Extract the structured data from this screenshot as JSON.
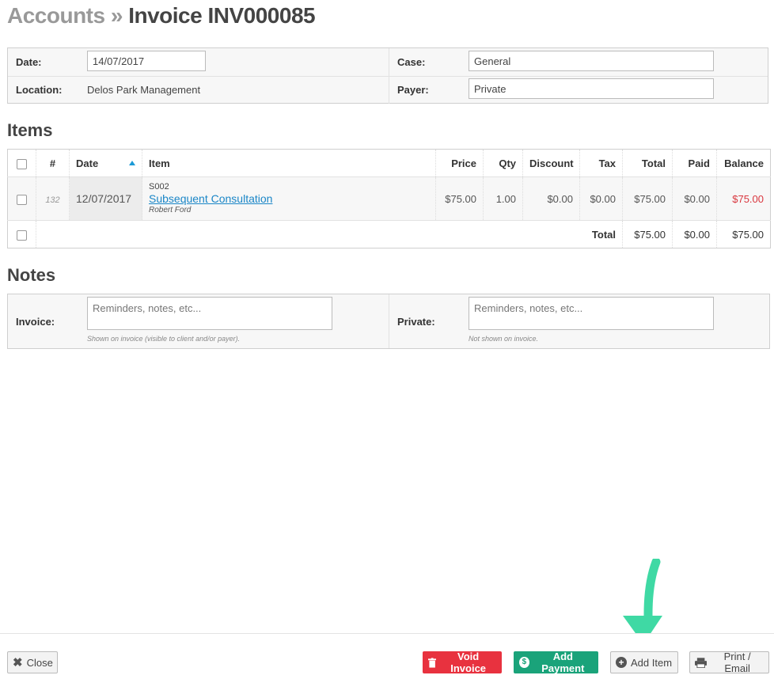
{
  "header": {
    "breadcrumb": "Accounts",
    "separator": "»",
    "title": "Invoice INV000085"
  },
  "details": {
    "date_label": "Date:",
    "date_value": "14/07/2017",
    "case_label": "Case:",
    "case_value": "General",
    "location_label": "Location:",
    "location_value": "Delos Park Management",
    "payer_label": "Payer:",
    "payer_value": "Private"
  },
  "items": {
    "heading": "Items",
    "columns": {
      "number": "#",
      "date": "Date",
      "item": "Item",
      "price": "Price",
      "qty": "Qty",
      "discount": "Discount",
      "tax": "Tax",
      "total": "Total",
      "paid": "Paid",
      "balance": "Balance"
    },
    "rows": [
      {
        "number": "132",
        "date": "12/07/2017",
        "code": "S002",
        "name": "Subsequent Consultation",
        "practitioner": "Robert Ford",
        "price": "$75.00",
        "qty": "1.00",
        "discount": "$0.00",
        "tax": "$0.00",
        "total": "$75.00",
        "paid": "$0.00",
        "balance": "$75.00"
      }
    ],
    "totals": {
      "label": "Total",
      "total": "$75.00",
      "paid": "$0.00",
      "balance": "$75.00"
    }
  },
  "notes": {
    "heading": "Notes",
    "invoice_label": "Invoice:",
    "invoice_placeholder": "Reminders, notes, etc...",
    "invoice_hint": "Shown on invoice (visible to client and/or payer).",
    "private_label": "Private:",
    "private_placeholder": "Reminders, notes, etc...",
    "private_hint": "Not shown on invoice."
  },
  "footer": {
    "close": "Close",
    "void_invoice": "Void Invoice",
    "add_payment": "Add Payment",
    "add_item": "Add Item",
    "print_email": "Print / Email"
  },
  "colors": {
    "accent_link": "#1a86c7",
    "danger": "#e8323f",
    "success": "#1aa37a",
    "arrow": "#3fd9a4"
  }
}
